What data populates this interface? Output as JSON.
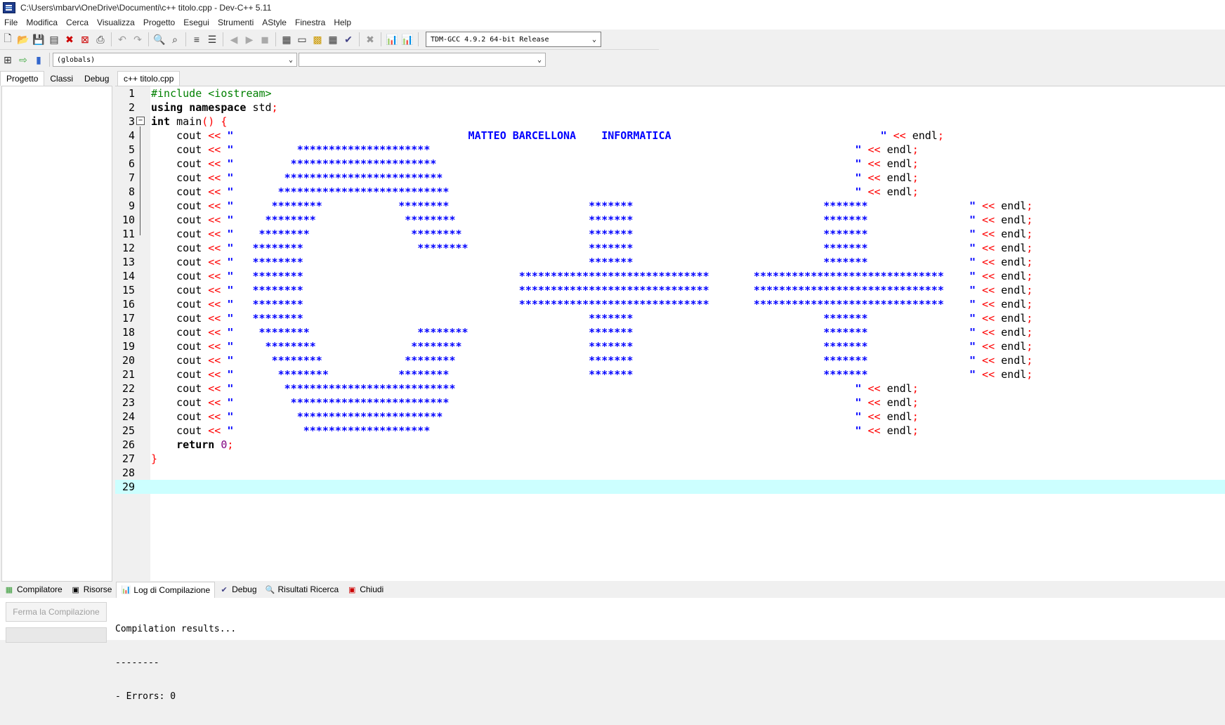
{
  "window": {
    "title": "C:\\Users\\mbarv\\OneDrive\\Documenti\\c++ titolo.cpp - Dev-C++ 5.11"
  },
  "menu": [
    "File",
    "Modifica",
    "Cerca",
    "Visualizza",
    "Progetto",
    "Esegui",
    "Strumenti",
    "AStyle",
    "Finestra",
    "Help"
  ],
  "toolbar": {
    "compiler": "TDM-GCC 4.9.2 64-bit Release",
    "scope": "(globals)",
    "member": ""
  },
  "left_tabs": [
    "Progetto",
    "Classi",
    "Debug"
  ],
  "editor_tab": "c++ titolo.cpp",
  "code_lines": [
    {
      "n": "1",
      "html": "<span class=\"pp\">#include &lt;iostream&gt;</span>"
    },
    {
      "n": "2",
      "html": "<span class=\"k\">using</span> <span class=\"k\">namespace</span> std<span class=\"op\">;</span>"
    },
    {
      "n": "3",
      "html": "<span class=\"k\">int</span> main<span class=\"op\">()</span> <span class=\"op\">{</span>"
    },
    {
      "n": "4",
      "html": "    cout <span class=\"op\">&lt;&lt;</span> <span class=\"str\">\"                                     MATTEO BARCELLONA    INFORMATICA                                 \"</span> <span class=\"op\">&lt;&lt;</span> endl<span class=\"op\">;</span>"
    },
    {
      "n": "5",
      "html": "    cout <span class=\"op\">&lt;&lt;</span> <span class=\"str\">\"          *********************                                                                   \"</span> <span class=\"op\">&lt;&lt;</span> endl<span class=\"op\">;</span>"
    },
    {
      "n": "6",
      "html": "    cout <span class=\"op\">&lt;&lt;</span> <span class=\"str\">\"         ***********************                                                                  \"</span> <span class=\"op\">&lt;&lt;</span> endl<span class=\"op\">;</span>"
    },
    {
      "n": "7",
      "html": "    cout <span class=\"op\">&lt;&lt;</span> <span class=\"str\">\"        *************************                                                                 \"</span> <span class=\"op\">&lt;&lt;</span> endl<span class=\"op\">;</span>"
    },
    {
      "n": "8",
      "html": "    cout <span class=\"op\">&lt;&lt;</span> <span class=\"str\">\"       ***************************                                                                \"</span> <span class=\"op\">&lt;&lt;</span> endl<span class=\"op\">;</span>"
    },
    {
      "n": "9",
      "html": "    cout <span class=\"op\">&lt;&lt;</span> <span class=\"str\">\"      ********            ********                      *******                              *******                \"</span> <span class=\"op\">&lt;&lt;</span> endl<span class=\"op\">;</span>"
    },
    {
      "n": "10",
      "html": "    cout <span class=\"op\">&lt;&lt;</span> <span class=\"str\">\"     ********              ********                     *******                              *******                \"</span> <span class=\"op\">&lt;&lt;</span> endl<span class=\"op\">;</span>"
    },
    {
      "n": "11",
      "html": "    cout <span class=\"op\">&lt;&lt;</span> <span class=\"str\">\"    ********                ********                    *******                              *******                \"</span> <span class=\"op\">&lt;&lt;</span> endl<span class=\"op\">;</span>"
    },
    {
      "n": "12",
      "html": "    cout <span class=\"op\">&lt;&lt;</span> <span class=\"str\">\"   ********                  ********                   *******                              *******                \"</span> <span class=\"op\">&lt;&lt;</span> endl<span class=\"op\">;</span>"
    },
    {
      "n": "13",
      "html": "    cout <span class=\"op\">&lt;&lt;</span> <span class=\"str\">\"   ********                                             *******                              *******                \"</span> <span class=\"op\">&lt;&lt;</span> endl<span class=\"op\">;</span>"
    },
    {
      "n": "14",
      "html": "    cout <span class=\"op\">&lt;&lt;</span> <span class=\"str\">\"   ********                                  ******************************       ******************************    \"</span> <span class=\"op\">&lt;&lt;</span> endl<span class=\"op\">;</span>"
    },
    {
      "n": "15",
      "html": "    cout <span class=\"op\">&lt;&lt;</span> <span class=\"str\">\"   ********                                  ******************************       ******************************    \"</span> <span class=\"op\">&lt;&lt;</span> endl<span class=\"op\">;</span>"
    },
    {
      "n": "16",
      "html": "    cout <span class=\"op\">&lt;&lt;</span> <span class=\"str\">\"   ********                                  ******************************       ******************************    \"</span> <span class=\"op\">&lt;&lt;</span> endl<span class=\"op\">;</span>"
    },
    {
      "n": "17",
      "html": "    cout <span class=\"op\">&lt;&lt;</span> <span class=\"str\">\"   ********                                             *******                              *******                \"</span> <span class=\"op\">&lt;&lt;</span> endl<span class=\"op\">;</span>"
    },
    {
      "n": "18",
      "html": "    cout <span class=\"op\">&lt;&lt;</span> <span class=\"str\">\"    ********                 ********                   *******                              *******                \"</span> <span class=\"op\">&lt;&lt;</span> endl<span class=\"op\">;</span>"
    },
    {
      "n": "19",
      "html": "    cout <span class=\"op\">&lt;&lt;</span> <span class=\"str\">\"     ********               ********                    *******                              *******                \"</span> <span class=\"op\">&lt;&lt;</span> endl<span class=\"op\">;</span>"
    },
    {
      "n": "20",
      "html": "    cout <span class=\"op\">&lt;&lt;</span> <span class=\"str\">\"      ********             ********                     *******                              *******                \"</span> <span class=\"op\">&lt;&lt;</span> endl<span class=\"op\">;</span>"
    },
    {
      "n": "21",
      "html": "    cout <span class=\"op\">&lt;&lt;</span> <span class=\"str\">\"       ********           ********                      *******                              *******                \"</span> <span class=\"op\">&lt;&lt;</span> endl<span class=\"op\">;</span>"
    },
    {
      "n": "22",
      "html": "    cout <span class=\"op\">&lt;&lt;</span> <span class=\"str\">\"        ***************************                                                               \"</span> <span class=\"op\">&lt;&lt;</span> endl<span class=\"op\">;</span>"
    },
    {
      "n": "23",
      "html": "    cout <span class=\"op\">&lt;&lt;</span> <span class=\"str\">\"         *************************                                                                \"</span> <span class=\"op\">&lt;&lt;</span> endl<span class=\"op\">;</span>"
    },
    {
      "n": "24",
      "html": "    cout <span class=\"op\">&lt;&lt;</span> <span class=\"str\">\"          ***********************                                                                 \"</span> <span class=\"op\">&lt;&lt;</span> endl<span class=\"op\">;</span>"
    },
    {
      "n": "25",
      "html": "    cout <span class=\"op\">&lt;&lt;</span> <span class=\"str\">\"           ********************                                                                   \"</span> <span class=\"op\">&lt;&lt;</span> endl<span class=\"op\">;</span>"
    },
    {
      "n": "26",
      "html": "    <span class=\"k\">return</span> <span class=\"num\">0</span><span class=\"op\">;</span>"
    },
    {
      "n": "27",
      "html": "<span class=\"op\">}</span>"
    },
    {
      "n": "28",
      "html": ""
    },
    {
      "n": "29",
      "html": ""
    }
  ],
  "bottom_tabs": [
    "Compilatore",
    "Risorse",
    "Log di Compilazione",
    "Debug",
    "Risultati Ricerca",
    "Chiudi"
  ],
  "stop_button": "Ferma la Compilazione",
  "log_lines": [
    "Compilation results...",
    "--------",
    "- Errors: 0"
  ]
}
